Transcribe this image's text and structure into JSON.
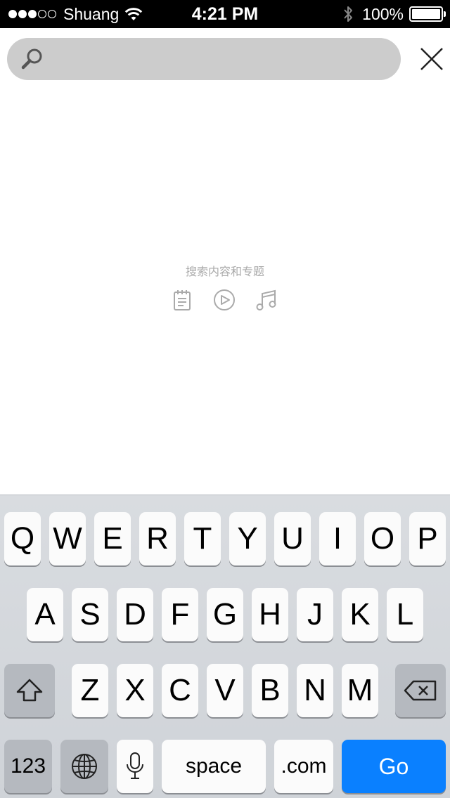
{
  "status_bar": {
    "carrier": "Shuang",
    "time": "4:21 PM",
    "battery_percent": "100%",
    "signal_bars_filled": 3,
    "signal_bars_total": 5
  },
  "search": {
    "value": "",
    "placeholder": ""
  },
  "empty_state": {
    "hint": "搜索内容和专题",
    "icons": [
      "notepad-icon",
      "play-icon",
      "music-note-icon"
    ]
  },
  "keyboard": {
    "row1": [
      "Q",
      "W",
      "E",
      "R",
      "T",
      "Y",
      "U",
      "I",
      "O",
      "P"
    ],
    "row2": [
      "A",
      "S",
      "D",
      "F",
      "G",
      "H",
      "J",
      "K",
      "L"
    ],
    "row3": [
      "Z",
      "X",
      "C",
      "V",
      "B",
      "N",
      "M"
    ],
    "numbers_label": "123",
    "space_label": "space",
    "dotcom_label": ".com",
    "go_label": "Go",
    "go_color": "#0a80ff"
  }
}
